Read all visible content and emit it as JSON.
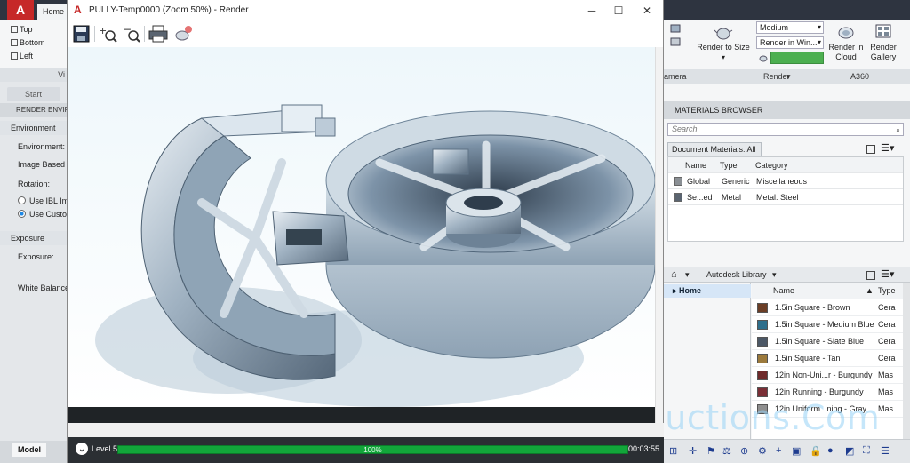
{
  "autocad": {
    "home_tab": "Home",
    "views": [
      "Top",
      "Bottom",
      "Left"
    ],
    "views_panel_label": "Vi",
    "start_tab": "Start",
    "render_env_header": "RENDER ENVIR",
    "environment_section": "Environment",
    "environment_label": "Environment:",
    "ibl_label": "Image Based L",
    "rotation_label": "Rotation:",
    "use_ibl_option": "Use IBL Im",
    "use_custom_option": "Use Custo",
    "exposure_section": "Exposure",
    "exposure_label": "Exposure:",
    "white_balance_label": "White Balance",
    "model_tab": "Model",
    "render_to_size": "Render to Size",
    "quality_preset": "Medium",
    "render_location": "Render in Win...",
    "render_in_cloud": "Render in Cloud",
    "render_gallery": "Render Gallery",
    "camera_label": "amera",
    "render_panel_label": "Render",
    "a360_label": "A360"
  },
  "materials_browser": {
    "title": "MATERIALS BROWSER",
    "search_placeholder": "Search",
    "document_filter": "Document Materials: All",
    "doc_columns": [
      "Name",
      "Type",
      "Category"
    ],
    "doc_rows": [
      {
        "name": "Global",
        "type": "Generic",
        "category": "Miscellaneous",
        "swatch": "#8a8f94"
      },
      {
        "name": "Se...ed",
        "type": "Metal",
        "category": "Metal: Steel",
        "swatch": "#5a6470"
      }
    ],
    "library_name": "Autodesk Library",
    "tree_home": "Home",
    "lib_columns": [
      "Name",
      "Type"
    ],
    "lib_rows": [
      {
        "name": "1.5in Square - Brown",
        "type": "Cera",
        "swatch": "#6b3e26"
      },
      {
        "name": "1.5in Square - Medium Blue",
        "type": "Cera",
        "swatch": "#2e6f8c"
      },
      {
        "name": "1.5in Square - Slate Blue",
        "type": "Cera",
        "swatch": "#4c5866"
      },
      {
        "name": "1.5in Square - Tan",
        "type": "Cera",
        "swatch": "#9c7a3c"
      },
      {
        "name": "12in Non-Uni...r - Burgundy",
        "type": "Mas",
        "swatch": "#6e2a2a"
      },
      {
        "name": "12in Running - Burgundy",
        "type": "Mas",
        "swatch": "#7a2f36"
      },
      {
        "name": "12in Uniform...ning - Gray",
        "type": "Mas",
        "swatch": "#8f8f8f"
      }
    ]
  },
  "render_window": {
    "title": "PULLY-Temp0000 (Zoom 50%) - Render",
    "level_label": "Level 5",
    "progress_percent": 100,
    "progress_text": "100%",
    "elapsed_time": "00:03:55"
  },
  "watermark": "LinhProductions.Com"
}
